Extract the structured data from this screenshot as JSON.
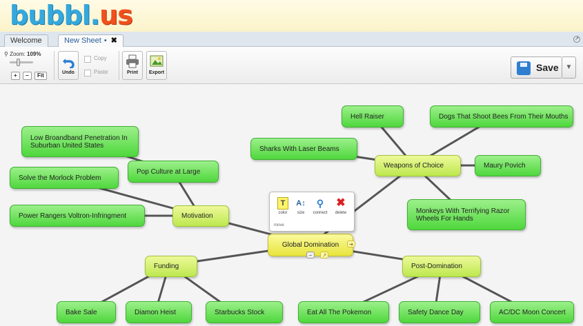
{
  "app": {
    "logo_main": "bubbl.",
    "logo_accent": "us"
  },
  "tabs": [
    {
      "label": "Welcome",
      "active": false
    },
    {
      "label": "New Sheet",
      "active": true,
      "dot": "•",
      "close": "✖"
    }
  ],
  "toolbar": {
    "zoom_label": "Zoom:",
    "zoom_value": "109%",
    "zoom_in": "+",
    "zoom_out": "−",
    "fit": "Fit",
    "undo": "Undo",
    "copy": "Copy",
    "paste": "Paste",
    "print": "Print",
    "export": "Export",
    "save": "Save",
    "save_menu": "▼"
  },
  "node_popup": {
    "color": "color",
    "size": "size",
    "connect": "connect",
    "delete": "delete",
    "move": "move"
  },
  "map": {
    "root": "Global Domination",
    "nodes": {
      "hell_raiser": "Hell Raiser",
      "dogs_bees": "Dogs That Shoot Bees From Their Mouths",
      "sharks_lasers": "Sharks With Laser Beams",
      "weapons": "Weapons of Choice",
      "maury": "Maury Povich",
      "monkeys": "Monkeys With Terrifying Razor Wheels For Hands",
      "broadband": "Low Broandband Penetration In Suburban United States",
      "pop_culture": "Pop Culture at Large",
      "morlock": "Solve the Morlock Problem",
      "power_rangers": "Power Rangers Voltron-Infringment",
      "motivation": "Motivation",
      "funding": "Funding",
      "post_domination": "Post-Domination",
      "bake_sale": "Bake Sale",
      "diamon_heist": "Diamon Heist",
      "starbucks": "Starbucks Stock",
      "pokemon": "Eat All The Pokemon",
      "safety_dance": "Safety Dance Day",
      "acdc": "AC/DC Moon Concert"
    }
  },
  "colors": {
    "node_green": "#6be157",
    "node_yellow_green": "#d4f06a",
    "root_yellow": "#f2ef5c",
    "link": "#555555"
  }
}
